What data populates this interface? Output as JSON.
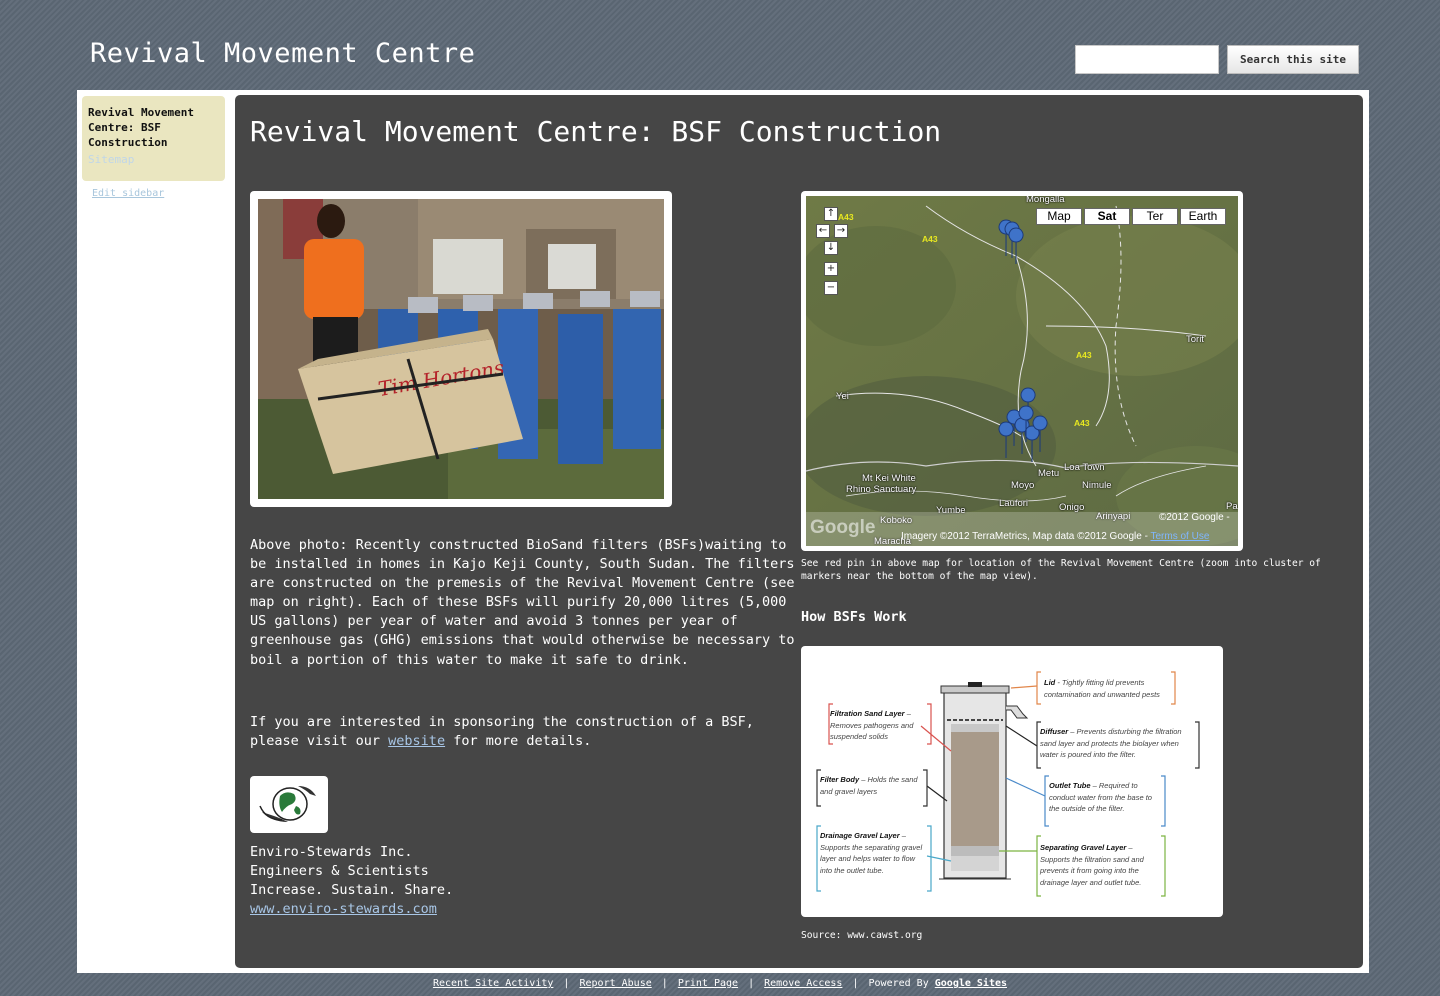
{
  "site": {
    "title": "Revival Movement Centre"
  },
  "search": {
    "placeholder": "",
    "button_label": "Search this site"
  },
  "sidebar": {
    "current_page": "Revival Movement Centre: BSF Construction",
    "sitemap_label": "Sitemap",
    "edit_sidebar_label": "Edit sidebar"
  },
  "page": {
    "title": "Revival Movement Centre: BSF Construction",
    "paragraph1": "Above photo: Recently constructed BioSand filters (BSFs)waiting to be installed in homes in Kajo Keji County, South Sudan. The filters are constructed on the premesis of the Revival Movement Centre (see map on right). Each of these BSFs will purify 20,000 litres (5,000 US gallons) per year of water and avoid 3 tonnes per year of greenhouse gas (GHG) emissions that would otherwise be necessary to boil a portion of this water to make it safe to drink.",
    "paragraph2_before": "If you are interested in sponsoring the construction of a BSF, please visit our ",
    "paragraph2_link": "website",
    "paragraph2_after": " for more details.",
    "org_name": "Enviro-Stewards Inc.",
    "org_tagline1": "Engineers & Scientists",
    "org_tagline2": "Increase. Sustain. Share.",
    "org_url": "www.enviro-stewards.com",
    "map_caption": "See red pin in above map for location of the Revival Movement Centre (zoom into cluster of markers near the bottom of the map view).",
    "how_heading": "How BSFs Work",
    "source": "Source: www.cawst.org"
  },
  "map": {
    "types": [
      "Map",
      "Sat",
      "Ter",
      "Earth"
    ],
    "active_type": "Sat",
    "places": {
      "mongalla": "Mongalla",
      "torit": "Torit",
      "yei": "Yei",
      "mt_kei": "Mt Kei White",
      "rhino": "Rhino Sanctuary",
      "metu": "Metu",
      "loa": "Loa Town",
      "moyo": "Moyo",
      "nimule": "Nimule",
      "yumbe": "Yumbe",
      "laufori": "Laufori",
      "onigo": "Onigo",
      "arinyapi": "Arinyapi",
      "koboko": "Koboko",
      "maracha": "Maracha",
      "pa": "Pa"
    },
    "roads": [
      "A43",
      "A43",
      "A43",
      "A43"
    ],
    "copyright": "©2012 Google -",
    "imagery": "Imagery ©2012 TerraMetrics, Map data ©2012 Google - ",
    "terms": "Terms of Use",
    "google_logo": "Google"
  },
  "diagram": {
    "lid_title": "Lid",
    "lid_desc": " - Tightly fitting lid prevents contamination and unwanted pests",
    "sand_title": "Filtration Sand Layer",
    "sand_desc": " – Removes pathogens and suspended solids",
    "diffuser_title": "Diffuser",
    "diffuser_desc": " – Prevents disturbing the filtration sand layer and protects the biolayer when water is poured into the filter.",
    "body_title": "Filter Body",
    "body_desc": " – Holds the sand and gravel layers",
    "outlet_title": "Outlet Tube",
    "outlet_desc": " – Required to conduct water from the base to the outside of the filter.",
    "drain_title": "Drainage Gravel Layer",
    "drain_desc": " – Supports the separating gravel layer and helps water to flow into the outlet tube.",
    "sep_title": "Separating Gravel Layer",
    "sep_desc": " – Supports the filtration sand and prevents it from going into the drainage layer and outlet tube."
  },
  "footer": {
    "recent_activity": "Recent Site Activity",
    "report_abuse": "Report Abuse",
    "print_page": "Print Page",
    "remove_access": "Remove Access",
    "powered_by": "Powered By",
    "google_sites": "Google Sites",
    "separator": "|"
  }
}
